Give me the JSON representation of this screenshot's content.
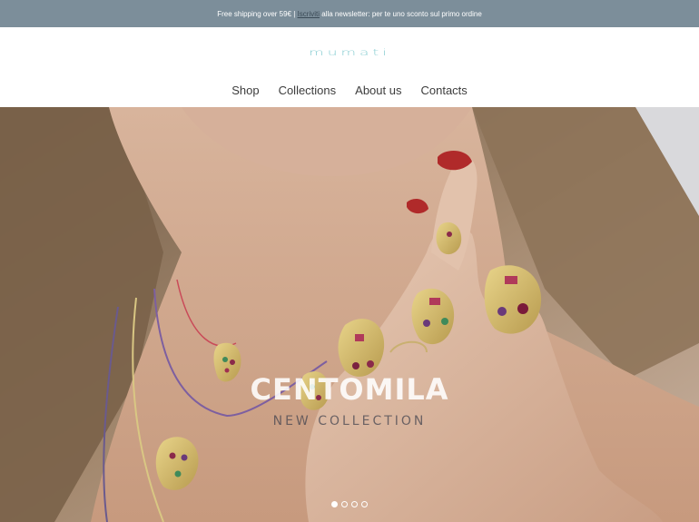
{
  "announcement": {
    "before": "Free shipping over 59€ | ",
    "link": "Iscriviti",
    "after": " alla newsletter: per te uno sconto sul primo ordine"
  },
  "brand": {
    "logo": "mumati",
    "logo_color": "#8ccfd3"
  },
  "nav": {
    "items": [
      "Shop",
      "Collections",
      "About us",
      "Contacts"
    ]
  },
  "hero": {
    "title": "CENTOMILA",
    "subtitle": "NEW COLLECTION",
    "slides": 4,
    "active_slide": 1
  },
  "colors": {
    "announcement_bg": "#7c8e9a",
    "accent": "#8ccfd3"
  }
}
